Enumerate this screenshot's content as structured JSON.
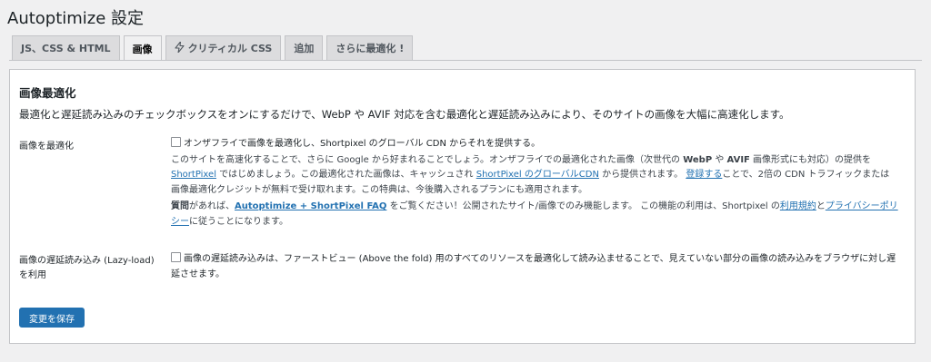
{
  "header": {
    "title": "Autoptimize 設定"
  },
  "tabs": [
    {
      "label": "JS、CSS & HTML",
      "active": false
    },
    {
      "label": "画像",
      "active": true
    },
    {
      "label": "クリティカル CSS",
      "active": false,
      "icon": "lightning-icon"
    },
    {
      "label": "追加",
      "active": false
    },
    {
      "label": "さらに最適化 !",
      "active": false
    }
  ],
  "section": {
    "title": "画像最適化",
    "intro": "最適化と遅延読み込みのチェックボックスをオンにするだけで、WebP や AVIF 対応を含む最適化と遅延読み込みにより、そのサイトの画像を大幅に高速化します。"
  },
  "optimize": {
    "label": "画像を最適化",
    "checkbox_text": "オンザフライで画像を最適化し、Shortpixel のグローバル CDN からそれを提供する。",
    "desc1_a": "このサイトを高速化することで、さらに Google から好まれることでしょう。オンザフライでの最適化された画像（次世代の ",
    "desc1_webp": "WebP",
    "desc1_b": " や ",
    "desc1_avif": "AVIF",
    "desc1_c": " 画像形式にも対応）の提供を ",
    "desc1_link1": "ShortPixel",
    "desc1_d": " ではじめましょう。この最適化された画像は、キャッシュされ ",
    "desc1_link2": "ShortPixel のグローバルCDN",
    "desc1_e": " から提供されます。",
    "desc1_link3": "登録する",
    "desc1_f": "ことで、2倍の CDN トラフィックまたは画像最適化クレジットが無料で受け取れます。この特典は、今後購入されるプランにも適用されます。",
    "q_bold": "質問",
    "q_a": "があれば、",
    "q_link": "Autoptimize + ShortPixel FAQ",
    "q_b": " をご覧ください！公開されたサイト/画像でのみ機能します。 この機能の利用は、Shortpixel の",
    "q_link2": "利用規約",
    "q_c": "と",
    "q_link3": "プライバシーポリシー",
    "q_d": "に従うことになります。"
  },
  "lazy": {
    "label": "画像の遅延読み込み (Lazy-load) を利用",
    "checkbox_text": "画像の遅延読み込みは、ファーストビュー (Above the fold) 用のすべてのリソースを最適化して読み込ませることで、見えていない部分の画像の読み込みをブラウザに対し遅延させます。"
  },
  "save_label": "変更を保存"
}
